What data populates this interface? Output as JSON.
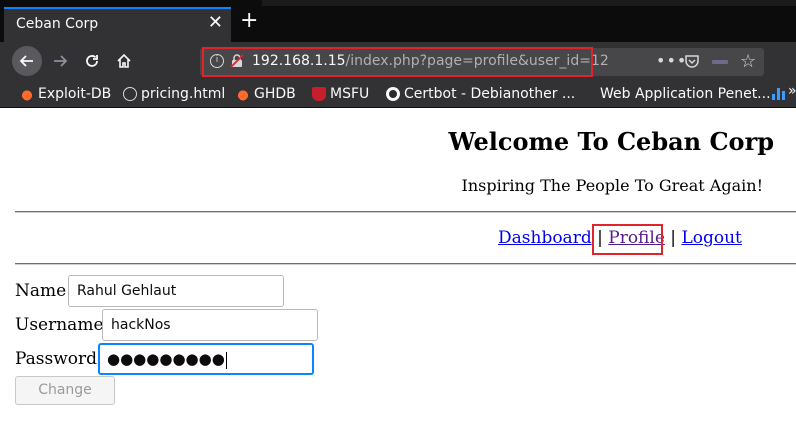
{
  "browser": {
    "tab": {
      "title": "Ceban Corp",
      "close": "✕"
    },
    "new_tab": "+",
    "url": {
      "host": "192.168.1.15",
      "path": "/index.php?page=profile&user_id=12"
    },
    "url_actions": {
      "more": "•••"
    },
    "bookmarks": [
      {
        "label": "Exploit-DB",
        "icon": "flame-icon"
      },
      {
        "label": "pricing.html",
        "icon": "globe-icon"
      },
      {
        "label": "GHDB",
        "icon": "flame-icon"
      },
      {
        "label": "MSFU",
        "icon": "msfu-icon"
      },
      {
        "label": "Certbot - Debianother ...",
        "icon": "certbot-icon"
      },
      {
        "label": "Web Application Penet...",
        "icon": "none"
      }
    ],
    "bookmarks_more": "»",
    "accent": "#0a84ff",
    "highlight_color": "#e0242b"
  },
  "page": {
    "heading": "Welcome To Ceban Corp",
    "tagline": "Inspiring The People To Great Again!",
    "nav": [
      {
        "label": "Dashboard"
      },
      {
        "label": "Profile"
      },
      {
        "label": "Logout"
      }
    ],
    "nav_separator": "|",
    "form": {
      "name_label": "Name",
      "name_value": "Rahul Gehlaut",
      "username_label": "Username",
      "username_value": "hackNos",
      "password_label": "Password",
      "password_mask": "●●●●●●●●●",
      "submit_label": "Change"
    }
  }
}
